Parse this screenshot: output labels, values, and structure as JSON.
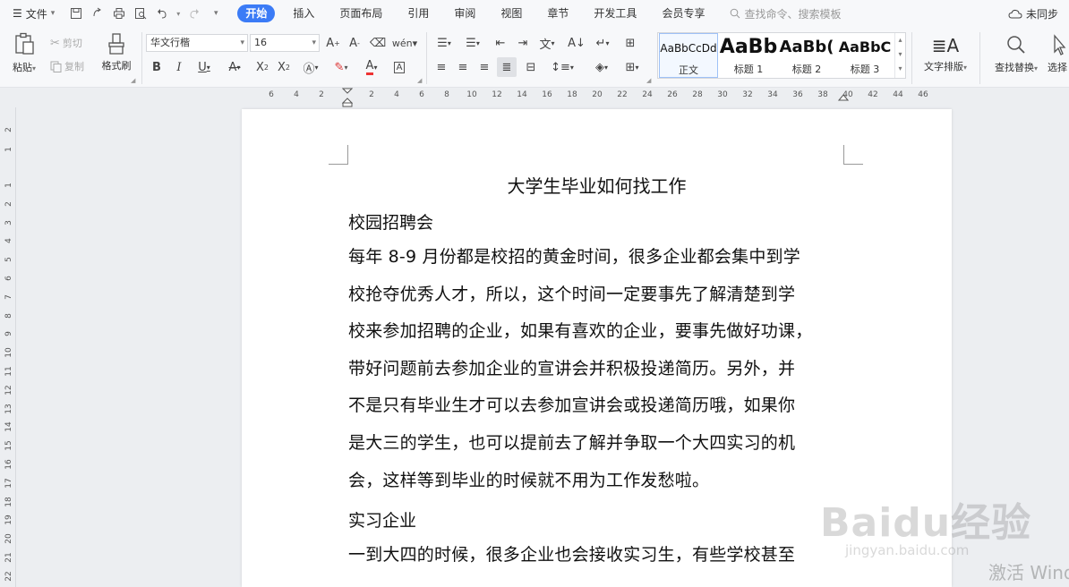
{
  "menubar": {
    "file_label": "文件",
    "tabs": [
      {
        "label": "开始",
        "active": true
      },
      {
        "label": "插入"
      },
      {
        "label": "页面布局"
      },
      {
        "label": "引用"
      },
      {
        "label": "审阅"
      },
      {
        "label": "视图"
      },
      {
        "label": "章节"
      },
      {
        "label": "开发工具"
      },
      {
        "label": "会员专享"
      }
    ],
    "search_placeholder": "查找命令、搜索模板",
    "sync_label": "未同步"
  },
  "ribbon": {
    "paste_label": "粘贴",
    "cut_label": "剪切",
    "copy_label": "复制",
    "format_painter_label": "格式刷",
    "font_name": "华文行楷",
    "font_size": "16",
    "styles": [
      {
        "preview": "AaBbCcDd",
        "label": "正文",
        "selected": true
      },
      {
        "preview": "AaBb",
        "label": "标题 1"
      },
      {
        "preview": "AaBb(",
        "label": "标题 2"
      },
      {
        "preview": "AaBbC",
        "label": "标题 3"
      }
    ],
    "text_layout_label": "文字排版",
    "find_replace_label": "查找替换",
    "select_label": "选择"
  },
  "ruler": {
    "h_ticks": [
      "6",
      "4",
      "2",
      "2",
      "4",
      "6",
      "8",
      "10",
      "12",
      "14",
      "16",
      "18",
      "20",
      "22",
      "24",
      "26",
      "28",
      "30",
      "32",
      "34",
      "36",
      "38",
      "40",
      "42",
      "44",
      "46"
    ],
    "v_ticks": [
      "2",
      "1",
      "1",
      "2",
      "3",
      "4",
      "5",
      "6",
      "7",
      "8",
      "9",
      "10",
      "11",
      "12",
      "13",
      "14",
      "15",
      "16",
      "17",
      "18",
      "19",
      "20",
      "21",
      "22"
    ]
  },
  "document": {
    "title": "大学生毕业如何找工作",
    "heading1": "校园招聘会",
    "paragraph1": [
      "每年 8-9 月份都是校招的黄金时间，很多企业都会集中到学",
      "校抢夺优秀人才，所以，这个时间一定要事先了解清楚到学",
      "校来参加招聘的企业，如果有喜欢的企业，要事先做好功课，",
      "带好问题前去参加企业的宣讲会并积极投递简历。另外，并",
      "不是只有毕业生才可以去参加宣讲会或投递简历哦，如果你",
      "是大三的学生，也可以提前去了解并争取一个大四实习的机",
      "会，这样等到毕业的时候就不用为工作发愁啦。"
    ],
    "heading2": "实习企业",
    "paragraph2": [
      "一到大四的时候，很多企业也会接收实习生，有些学校甚至"
    ]
  },
  "watermark": {
    "logo": "Baidu经验",
    "url": "jingyan.baidu.com",
    "activate": "激活 Wind"
  }
}
